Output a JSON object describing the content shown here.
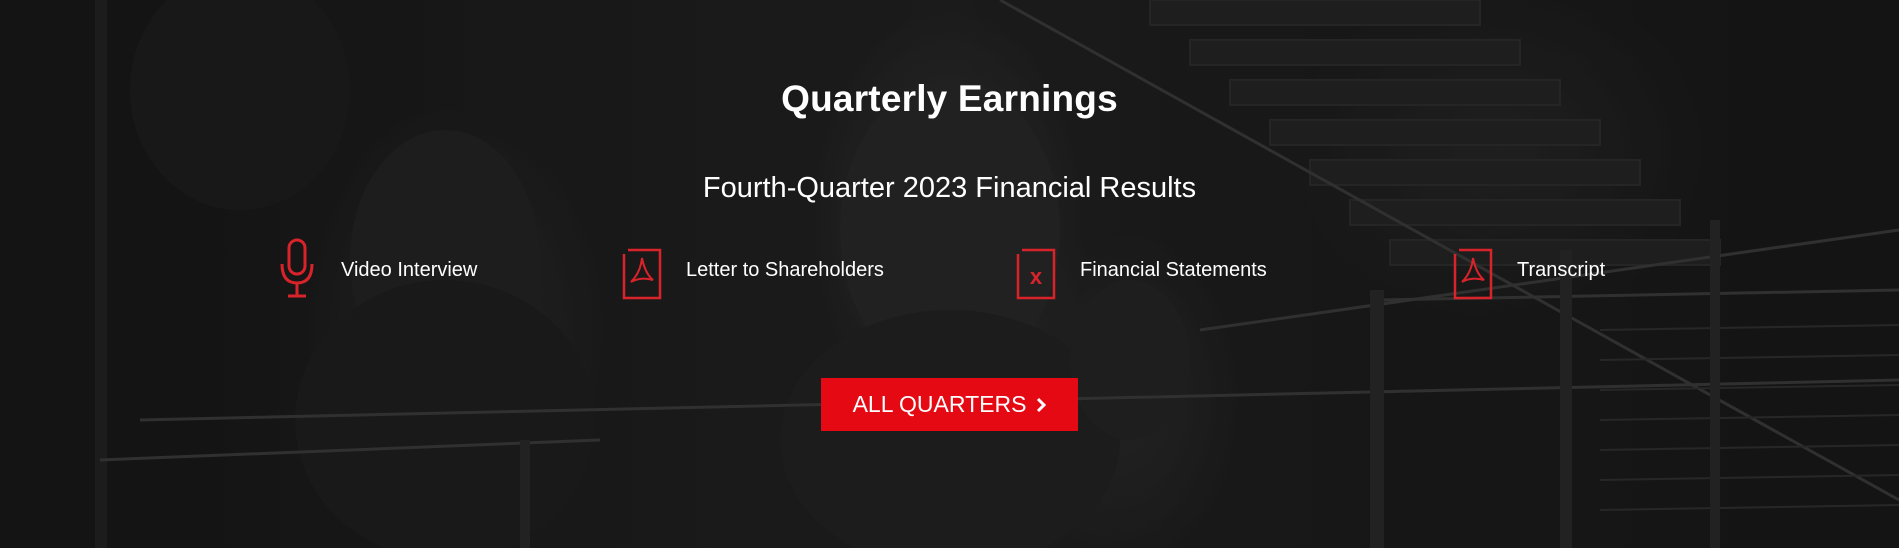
{
  "hero": {
    "title": "Quarterly Earnings",
    "subtitle": "Fourth-Quarter 2023 Financial Results",
    "links": [
      {
        "label": "Video Interview",
        "icon": "microphone-icon"
      },
      {
        "label": "Letter to Shareholders",
        "icon": "pdf-icon"
      },
      {
        "label": "Financial Statements",
        "icon": "excel-icon"
      },
      {
        "label": "Transcript",
        "icon": "pdf-icon"
      }
    ],
    "cta": {
      "label": "ALL QUARTERS",
      "icon": "chevron-right-icon"
    }
  },
  "colors": {
    "accent": "#e50914",
    "icon_red": "#d9232b",
    "text": "#ffffff"
  }
}
